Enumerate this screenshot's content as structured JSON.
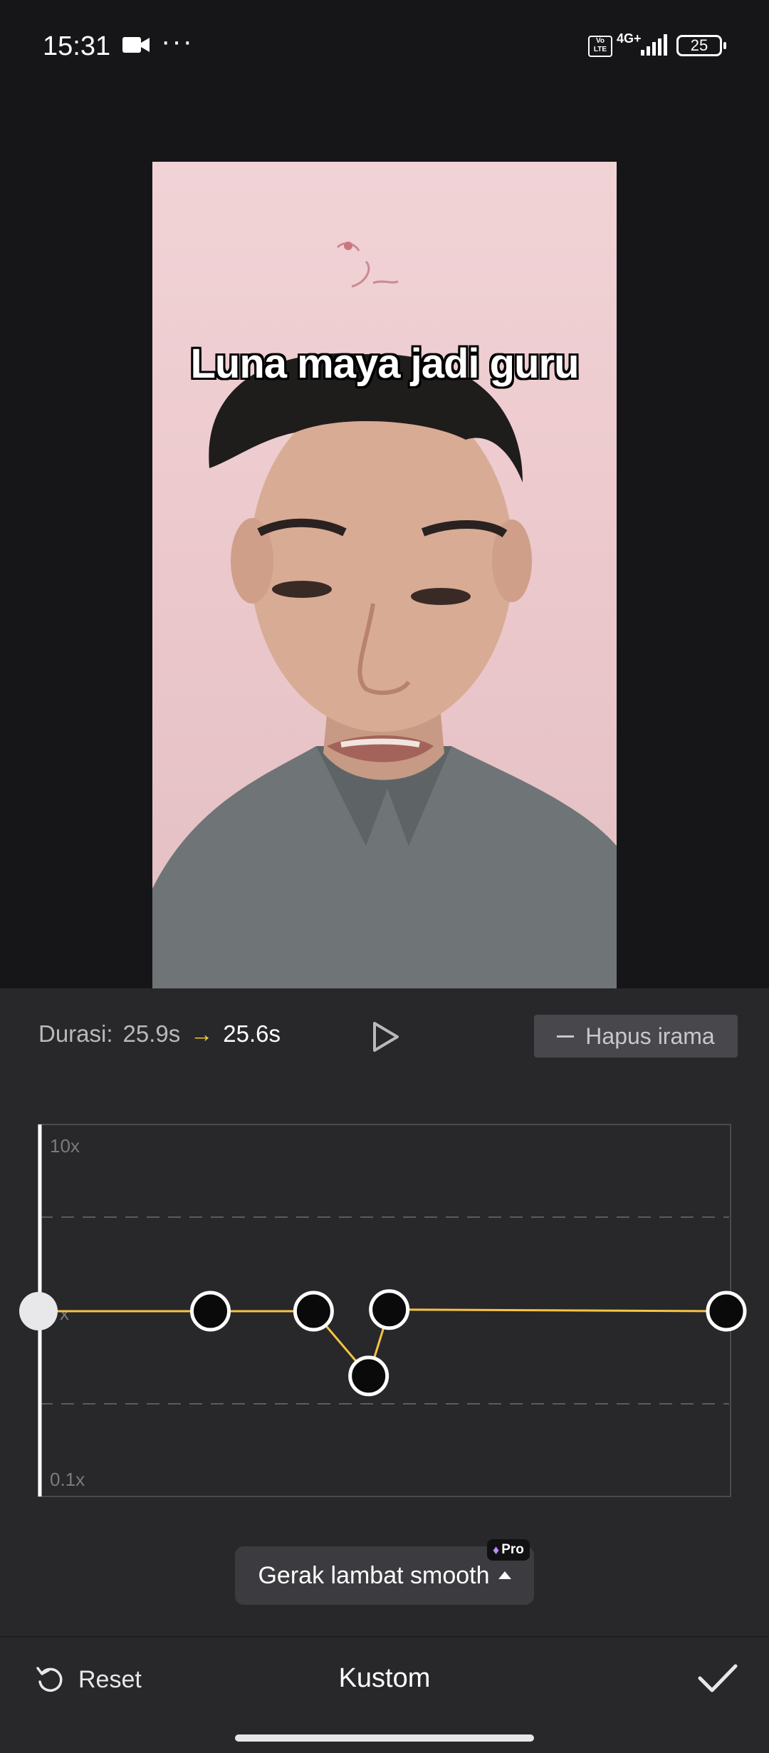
{
  "status_bar": {
    "time": "15:31",
    "more": "···",
    "volte": "Vo LTE",
    "network": "4G+",
    "battery": "25"
  },
  "video": {
    "caption": "Luna maya jadi guru"
  },
  "controls": {
    "duration_label": "Durasi:",
    "duration_from": "25.9s",
    "duration_arrow": "→",
    "duration_to": "25.6s",
    "remove_beat_label": "Hapus irama"
  },
  "speed_curve": {
    "max_label": "10x",
    "mid_label": "x",
    "min_label": "0.1x",
    "playhead_position": 0.0,
    "points": [
      {
        "t": 0.25,
        "speed": 1.0
      },
      {
        "t": 0.4,
        "speed": 1.0
      },
      {
        "t": 0.48,
        "speed": 0.45
      },
      {
        "t": 0.51,
        "speed": 1.02
      },
      {
        "t": 1.0,
        "speed": 1.0
      }
    ],
    "curve_color": "#f5c542"
  },
  "effect": {
    "label": "Gerak lambat smooth",
    "badge": "Pro"
  },
  "footer": {
    "reset_label": "Reset",
    "title": "Kustom"
  },
  "colors": {
    "accent": "#f5d22c",
    "panel": "#28282b",
    "background": "#161618"
  }
}
